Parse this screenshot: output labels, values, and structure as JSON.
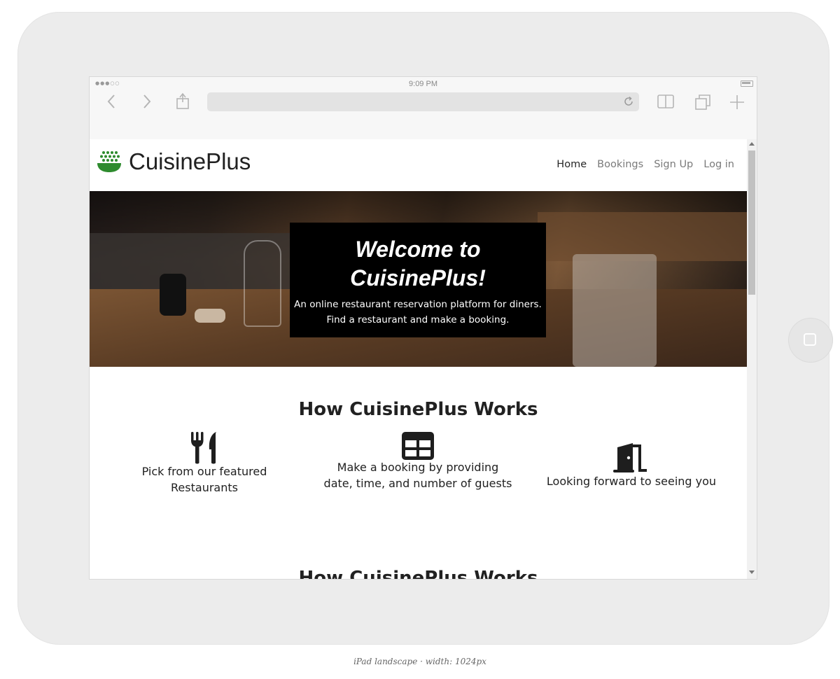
{
  "device": {
    "caption": "iPad landscape · width: 1024px"
  },
  "browser": {
    "status_time": "9:09 PM",
    "address_value": ""
  },
  "site": {
    "brand": "CuisinePlus",
    "nav": [
      {
        "label": "Home",
        "active": true
      },
      {
        "label": "Bookings",
        "active": false
      },
      {
        "label": "Sign Up",
        "active": false
      },
      {
        "label": "Log in",
        "active": false
      }
    ],
    "hero": {
      "title_line1": "Welcome to",
      "title_line2": "CuisinePlus!",
      "subtitle_line1": "An online restaurant reservation platform for diners.",
      "subtitle_line2": "Find a restaurant and make a booking."
    },
    "how_it_works": {
      "title": "How CuisinePlus Works",
      "steps": [
        {
          "icon": "utensils-icon",
          "line1": "Pick from our featured",
          "line2": "Restaurants"
        },
        {
          "icon": "table-icon",
          "line1": "Make a booking by providing",
          "line2": "date, time, and number of guests"
        },
        {
          "icon": "door-open-icon",
          "line1": "Looking forward to seeing you",
          "line2": ""
        }
      ],
      "repeated_title": "How CuisinePlus Works"
    }
  },
  "colors": {
    "brand_icon_green": "#2e8b2e",
    "text_dark": "#212121",
    "nav_muted": "#7a7a7a",
    "hero_box_bg": "#000000"
  }
}
